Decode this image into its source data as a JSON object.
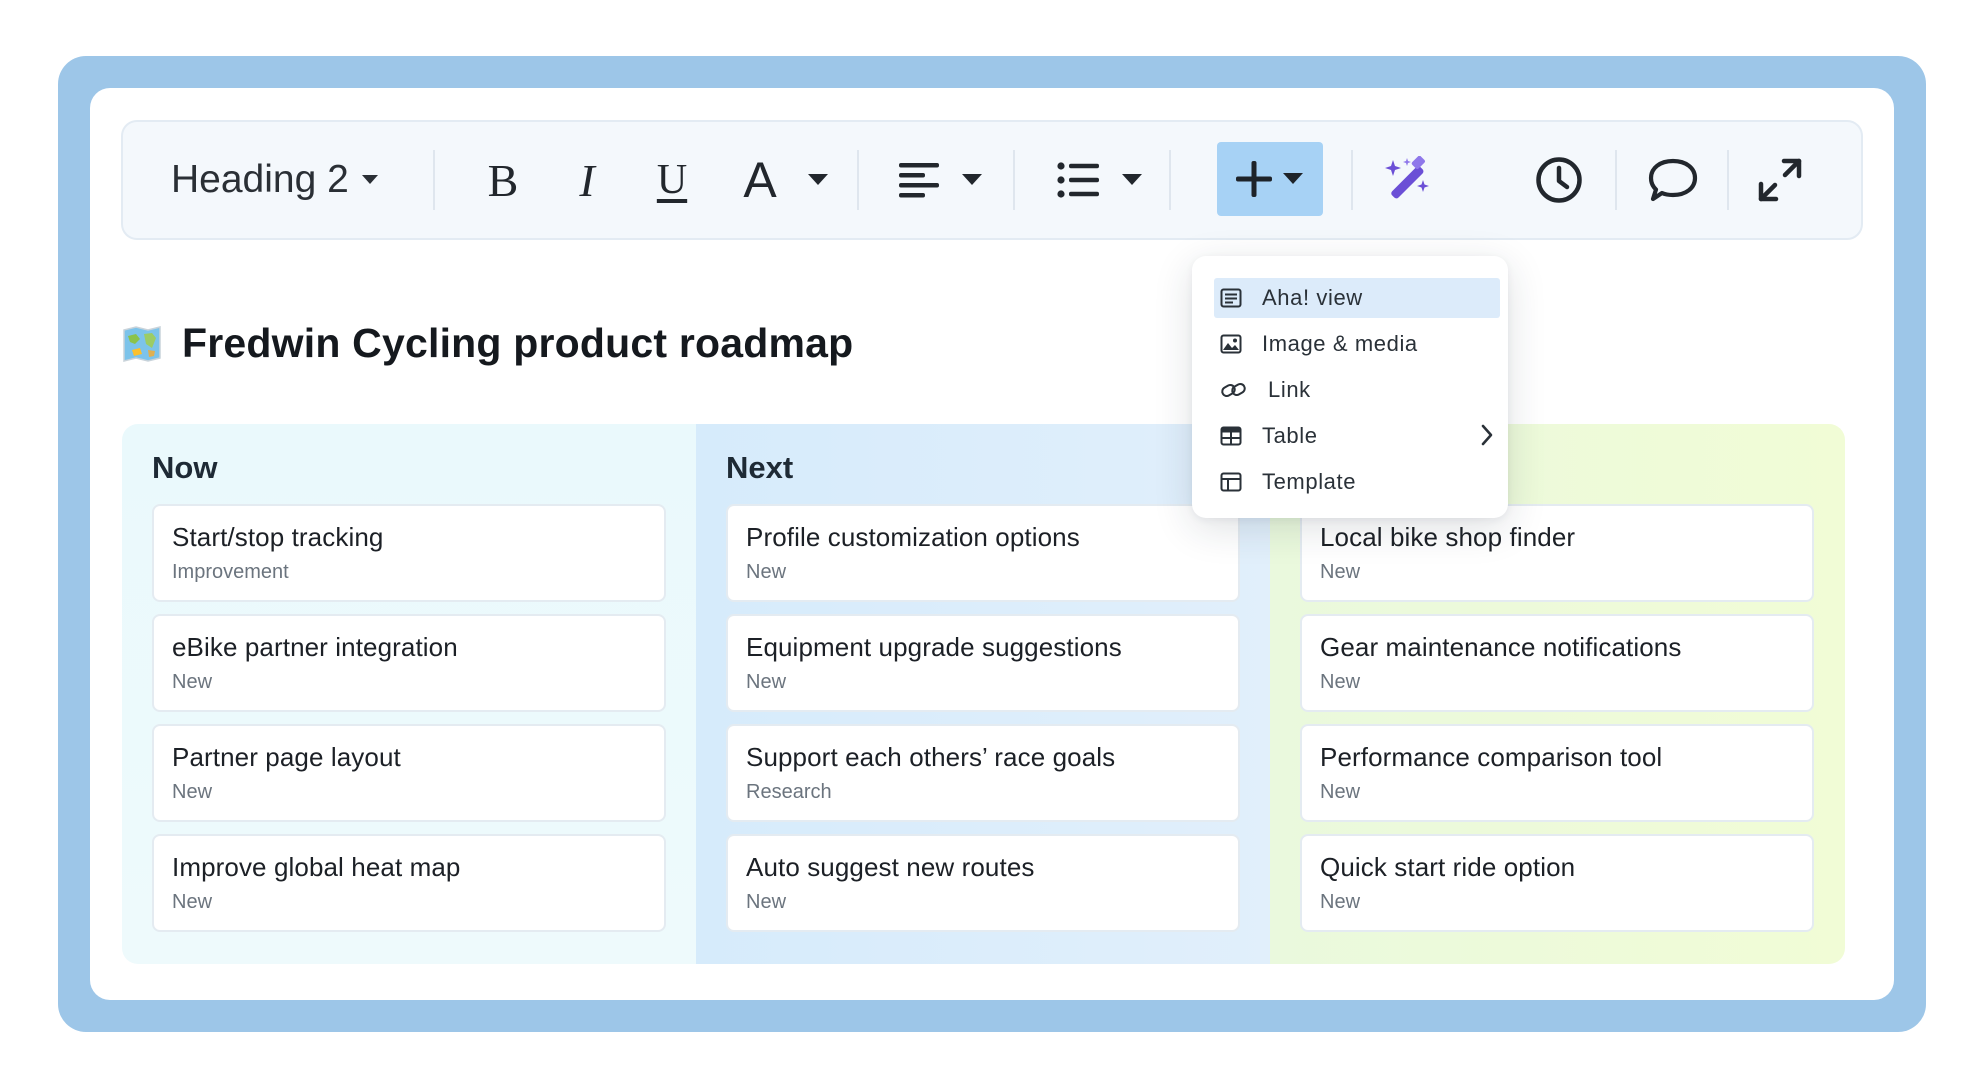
{
  "toolbar": {
    "heading_style": "Heading 2",
    "bold": "B",
    "italic": "I",
    "underline": "U",
    "text_color": "A"
  },
  "document": {
    "title": "Fredwin Cycling product roadmap"
  },
  "insert_menu": {
    "items": [
      {
        "label": "Aha! view",
        "icon": "view-icon",
        "active": true
      },
      {
        "label": "Image & media",
        "icon": "image-icon"
      },
      {
        "label": "Link",
        "icon": "link-icon"
      },
      {
        "label": "Table",
        "icon": "table-icon",
        "has_submenu": true
      },
      {
        "label": "Template",
        "icon": "template-icon"
      }
    ]
  },
  "board": {
    "columns": [
      {
        "title": "Now",
        "features": [
          {
            "name": "Start/stop tracking",
            "type": "Improvement"
          },
          {
            "name": "eBike partner integration",
            "type": "New"
          },
          {
            "name": "Partner page layout",
            "type": "New"
          },
          {
            "name": "Improve global heat map",
            "type": "New"
          }
        ]
      },
      {
        "title": "Next",
        "features": [
          {
            "name": "Profile customization options",
            "type": "New"
          },
          {
            "name": "Equipment upgrade suggestions",
            "type": "New"
          },
          {
            "name": "Support each others’ race goals",
            "type": "Research"
          },
          {
            "name": "Auto suggest new routes",
            "type": "New"
          }
        ]
      },
      {
        "title": "",
        "features": [
          {
            "name": "Local bike shop finder",
            "type": "New"
          },
          {
            "name": "Gear maintenance notifications",
            "type": "New"
          },
          {
            "name": "Performance comparison tool",
            "type": "New"
          },
          {
            "name": "Quick start ride option",
            "type": "New"
          }
        ]
      }
    ]
  },
  "colors": {
    "frame": "#9dc6e8",
    "insert_active": "#a7d2f5",
    "ai_accent": "#6b4fd6",
    "menu_active": "#dcebfa"
  }
}
